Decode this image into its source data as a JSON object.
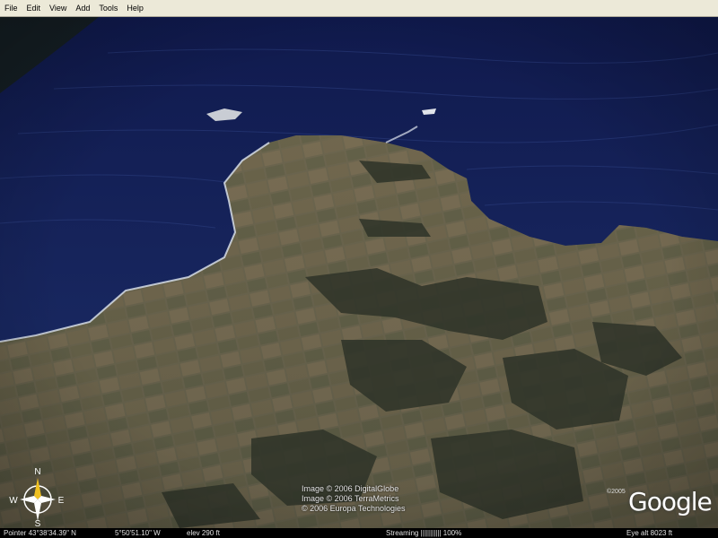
{
  "menu": [
    "File",
    "Edit",
    "View",
    "Add",
    "Tools",
    "Help"
  ],
  "compass": {
    "n": "N",
    "s": "S",
    "e": "E",
    "w": "W"
  },
  "credits": [
    "Image © 2006 DigitalGlobe",
    "Image © 2006 TerraMetrics",
    "© 2006 Europa Technologies"
  ],
  "logo": {
    "year": "©2005",
    "text": "Google"
  },
  "status": {
    "pointer": "Pointer  43°38'34.39\" N",
    "lon": "5°50'51.10\"  W",
    "elev": "elev  290 ft",
    "streaming": "Streaming ||||||||||| 100%",
    "eyealt": "Eye  alt   8023 ft"
  },
  "colors": {
    "sea": "#14235e",
    "land": "#6f6a52",
    "menubar": "#ece9d8"
  }
}
